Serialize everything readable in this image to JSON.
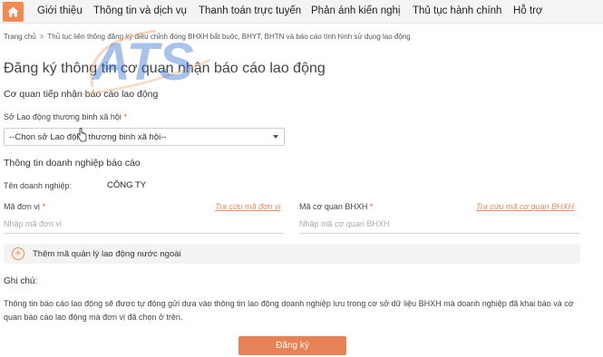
{
  "nav": {
    "items": [
      "Giới thiệu",
      "Thông tin và dịch vụ",
      "Thanh toán trực tuyến",
      "Phản ánh kiến nghị",
      "Thủ tục hành chính",
      "Hỗ trợ"
    ]
  },
  "breadcrumb": {
    "home": "Trang chủ",
    "current": "Thủ tục liên thông đăng ký điều chỉnh đóng BHXH bắt buộc, BHYT, BHTN và báo cáo tình hình sử dụng lao động"
  },
  "page": {
    "title": "Đăng ký thông tin cơ quan nhận báo cáo lao động"
  },
  "receiving_agency": {
    "heading": "Cơ quan tiếp nhận báo cáo lao động",
    "label": "Sở Lao động thương binh xã hội",
    "required": "*",
    "select_value": "--Chọn sở Lao động thương binh xã hội--"
  },
  "enterprise": {
    "heading": "Thông tin doanh nghiệp báo cáo",
    "name_label": "Tên doanh nghiệp:",
    "name_value": "CÔNG TY",
    "unit_code_label": "Mã đơn vị",
    "unit_code_lookup": "Tra cứu mã đơn vị",
    "unit_code_placeholder": "Nhập mã đơn vị",
    "bhxh_label": "Mã cơ quan BHXH",
    "bhxh_lookup": "Tra cứu mã cơ quan BHXH",
    "bhxh_placeholder": "Nhập mã cơ quan BHXH",
    "required": "*"
  },
  "foreign_mgmt": {
    "label": "Thêm mã quản lý lao động nước ngoài"
  },
  "note": {
    "heading": "Ghi chú:",
    "text": "Thông tin báo cáo lao động sẽ được tự động gửi dựa vào thông tin lao động doanh nghiệp lưu trong cơ sở dữ liệu BHXH mà doanh nghiệp đã khai báo và cơ quan báo cáo lao động mà đơn vị đã chọn ở trên."
  },
  "submit_label": "Đăng ký",
  "watermark_text": "ATS",
  "colors": {
    "accent": "#e68256",
    "link": "#e88b5f",
    "watermark": "#2f6fd1"
  }
}
